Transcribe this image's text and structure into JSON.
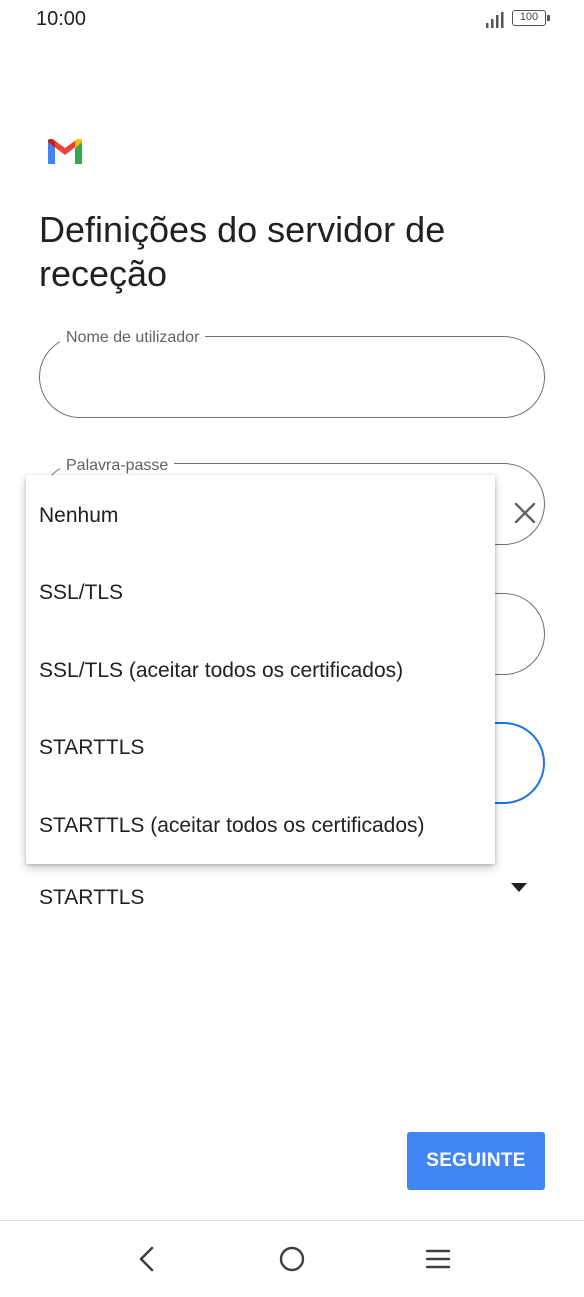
{
  "status_bar": {
    "time": "10:00",
    "battery": "100"
  },
  "icons": {
    "logo": "gmail-logo",
    "signal": "signal-icon",
    "clear": "close-icon",
    "dropdown": "dropdown-arrow-icon",
    "back": "nav-back-icon",
    "home": "nav-home-icon",
    "menu": "nav-menu-icon"
  },
  "colors": {
    "accent": "#4285f4",
    "focus": "#1a73e8",
    "gmail_red": "#ea4335",
    "gmail_blue": "#4285f4",
    "gmail_green": "#34a853",
    "gmail_yellow": "#fbbc04",
    "gmail_darkred": "#c5221f"
  },
  "page": {
    "title": "Definições do servidor de receção"
  },
  "form": {
    "username_label": "Nome de utilizador",
    "username_value": "",
    "password_label": "Palavra-passe",
    "password_value": "",
    "security_value": "STARTTLS"
  },
  "dropdown": {
    "options": [
      "Nenhum",
      "SSL/TLS",
      "SSL/TLS (aceitar todos os certificados)",
      "STARTTLS",
      "STARTTLS (aceitar todos os certificados)"
    ]
  },
  "actions": {
    "next_label": "SEGUINTE"
  }
}
